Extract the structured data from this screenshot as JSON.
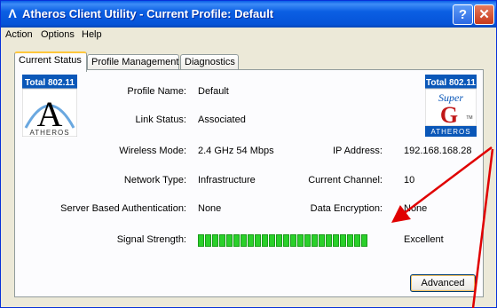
{
  "window": {
    "title": "Atheros Client Utility - Current Profile: Default",
    "title_icon": "Λ",
    "help_glyph": "?",
    "close_glyph": "✕"
  },
  "menu": [
    "Action",
    "Options",
    "Help"
  ],
  "tabs": [
    {
      "label": "Current Status",
      "active": true
    },
    {
      "label": "Profile Management",
      "active": false
    },
    {
      "label": "Diagnostics",
      "active": false
    }
  ],
  "status": {
    "profile_name_label": "Profile Name:",
    "profile_name": "Default",
    "link_status_label": "Link Status:",
    "link_status": "Associated",
    "wireless_mode_label": "Wireless Mode:",
    "wireless_mode": "2.4 GHz 54 Mbps",
    "ip_address_label": "IP Address:",
    "ip_address": "192.168.168.28",
    "network_type_label": "Network Type:",
    "network_type": "Infrastructure",
    "current_channel_label": "Current Channel:",
    "current_channel": "10",
    "server_auth_label": "Server Based Authentication:",
    "server_auth": "None",
    "data_encryption_label": "Data Encryption:",
    "data_encryption": "None",
    "signal_strength_label": "Signal Strength:",
    "signal_strength": "Excellent",
    "signal_level": 1.0
  },
  "logos": {
    "left": {
      "top": "Total 802.11",
      "bottom": "ATHEROS",
      "letter": "A"
    },
    "right": {
      "top": "Total 802.11",
      "mid": "Super",
      "letter": "G",
      "bottom": "ATHEROS",
      "tm": "TM"
    }
  },
  "buttons": {
    "advanced": "Advanced"
  },
  "colors": {
    "signal": "#2ad02a",
    "annotation_arrow": "#e00000"
  }
}
